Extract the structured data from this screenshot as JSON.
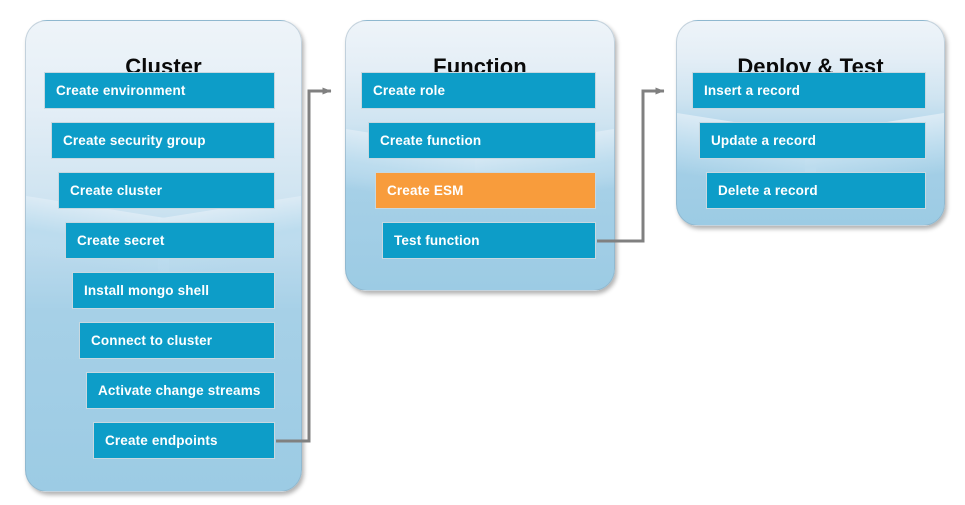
{
  "diagram": {
    "title_visible": false,
    "colors": {
      "step": "#0d9dc8",
      "step_accent": "#f89c3c",
      "panel_top": "#eef4f9",
      "panel_bottom": "#9ccbe4",
      "connector": "#808080",
      "title_text": "#0a0a0a",
      "step_text": "#ffffff"
    },
    "columns": [
      {
        "id": "cluster",
        "title": "Cluster",
        "steps": [
          {
            "label": "Create environment",
            "highlighted": false
          },
          {
            "label": "Create security group",
            "highlighted": false
          },
          {
            "label": "Create cluster",
            "highlighted": false
          },
          {
            "label": "Create secret",
            "highlighted": false
          },
          {
            "label": "Install mongo shell",
            "highlighted": false
          },
          {
            "label": "Connect to cluster",
            "highlighted": false
          },
          {
            "label": "Activate change streams",
            "highlighted": false
          },
          {
            "label": "Create endpoints",
            "highlighted": false
          }
        ]
      },
      {
        "id": "function",
        "title": "Function",
        "steps": [
          {
            "label": "Create role",
            "highlighted": false
          },
          {
            "label": "Create function",
            "highlighted": false
          },
          {
            "label": "Create ESM",
            "highlighted": true
          },
          {
            "label": "Test function",
            "highlighted": false
          }
        ]
      },
      {
        "id": "deploy-test",
        "title": "Deploy & Test",
        "steps": [
          {
            "label": "Insert a record",
            "highlighted": false
          },
          {
            "label": "Update a record",
            "highlighted": false
          },
          {
            "label": "Delete a record",
            "highlighted": false
          }
        ]
      }
    ],
    "connectors": [
      {
        "id": "cluster-to-function",
        "from": "cluster",
        "to": "function"
      },
      {
        "id": "function-to-deploy-test",
        "from": "function",
        "to": "deploy-test"
      }
    ]
  }
}
